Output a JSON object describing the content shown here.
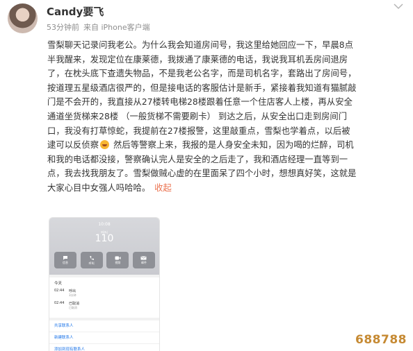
{
  "post": {
    "username": "Candy要飞",
    "time": "53分钟前",
    "source": "来自 iPhone客户端",
    "more_icon": "chevron-down-icon",
    "body_lines": [
      "雪梨聊天记录问我老公。为什么我会知道房间号，我这里给她回应一下，早晨8点",
      "半我醒来，发现定位在康莱德，我拨通了康莱德的电话，我说我耳机丢房间退房",
      "了，在枕头底下查遗失物品，不是我老公名字，而是司机名字，套路出了房间号，",
      "按道理五星级酒店很严的，但是接电话的客服估计是新手，紧接着我知道有猫腻敲",
      "门是不会开的，我直接从27楼转电梯28楼跟着任意一个住店客人上楼，再从安全",
      "通道坐货梯来28楼 （一般货梯不需要刷卡） 到达之后，从安全出口走到房间门",
      "口，我没有打草惊蛇，我提前在27楼报警，这里敲重点，雪梨也学着点，以后被"
    ],
    "line8_before_emoji": "逮可以反侦察",
    "line8_after_emoji": " 然后等警察上来，我报的是人身安全未知，因为喝的烂醉，司机",
    "body_lines_end": [
      "和我的电话都没接，警察确认完人是安全的之后走了，我和酒店经理一直等到一",
      "点，我去找我朋友了。雪梨做贼心虚的在里面呆了四个小时，想想真好笑，这就是"
    ],
    "last_line": "大家心目中女强人吗哈哈。",
    "collapse_label": "收起"
  },
  "screenshot": {
    "status_time": "10:08",
    "call_name": "呼叫",
    "call_number": "110",
    "actions": [
      {
        "icon": "message-icon",
        "label": "信息"
      },
      {
        "icon": "phone-icon",
        "label": "呼叫"
      },
      {
        "icon": "video-icon",
        "label": "视频"
      },
      {
        "icon": "mail-icon",
        "label": "邮件"
      }
    ],
    "history_title": "今天",
    "history": [
      {
        "time": "02:44",
        "type": "呼出",
        "sub": "3分钟"
      },
      {
        "time": "02:44",
        "type": "已取消",
        "sub": "已取消"
      }
    ],
    "menu": [
      "共享联系人",
      "新建联系人",
      "添加到现有联系人"
    ]
  },
  "watermark": "688788",
  "colors": {
    "text": "#333333",
    "meta": "#8e8e8e",
    "link": "#eb7350",
    "watermark": "#c68a33"
  }
}
